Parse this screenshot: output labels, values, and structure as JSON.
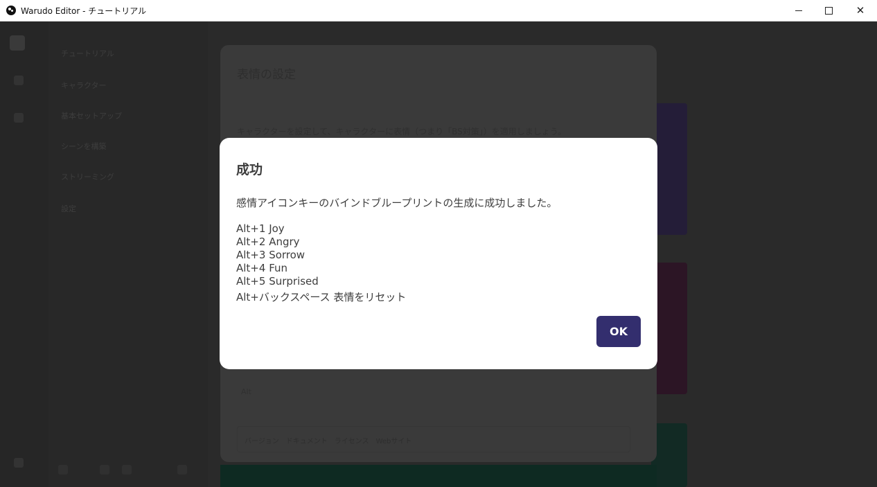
{
  "window": {
    "title": "Warudo Editor - チュートリアル",
    "icon": "warudo-app-icon",
    "controls": [
      "minimize",
      "maximize",
      "close"
    ],
    "close_glyph": "✕"
  },
  "background": {
    "dialog_title": "表情の設定",
    "dialog_description": "キャラクターを設定して、キャラクターに表情（つまり「BS対策」）を適用しましょう。",
    "row_label": "Alt",
    "footer_text": "バージョン　ドキュメント　ライセンス　Webサイト",
    "sidebar_items": [
      "チュートリアル",
      "キャラクター",
      "基本セットアップ",
      "シーンを構築",
      "ストリーミング",
      "設定"
    ]
  },
  "modal": {
    "title": "成功",
    "message": "感情アイコンキーのバインドブループリントの生成に成功しました。",
    "keybindings": [
      "Alt+1 Joy",
      "Alt+2 Angry",
      "Alt+3 Sorrow",
      "Alt+4 Fun",
      "Alt+5 Surprised",
      "Alt+バックスペース 表情をリセット"
    ],
    "ok_label": "OK",
    "ok_color": "#332e6e"
  }
}
